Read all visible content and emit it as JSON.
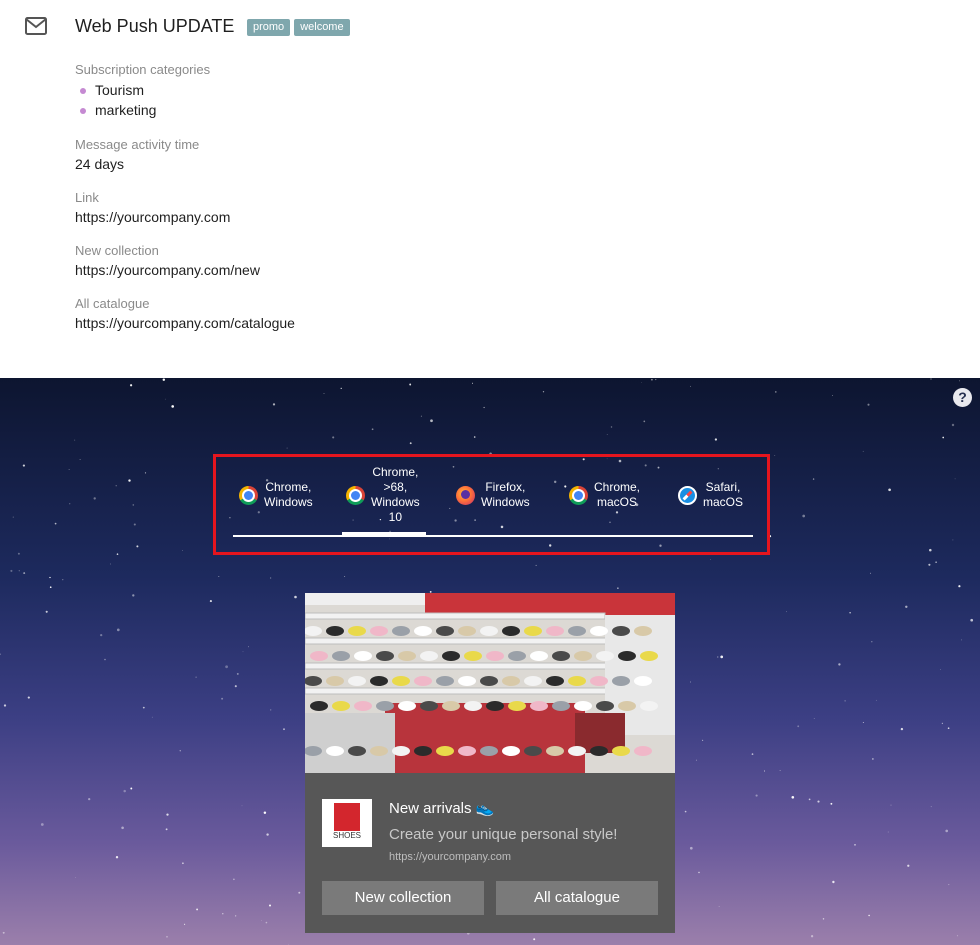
{
  "message": {
    "title": "Web Push UPDATE",
    "tags": [
      "promo",
      "welcome"
    ]
  },
  "fields": {
    "subscription_label": "Subscription categories",
    "subscription_items": [
      "Tourism",
      "marketing"
    ],
    "activity_label": "Message activity time",
    "activity_value": "24 days",
    "link_label": "Link",
    "link_value": "https://yourcompany.com",
    "new_collection_label": "New collection",
    "new_collection_value": "https://yourcompany.com/new",
    "catalogue_label": "All catalogue",
    "catalogue_value": "https://yourcompany.com/catalogue"
  },
  "preview": {
    "help_icon": "?",
    "browser_tabs": [
      {
        "label": "Chrome,\nWindows",
        "icon": "chrome-icon"
      },
      {
        "label": "Chrome,\n>68,\nWindows\n10",
        "icon": "chrome-icon",
        "active": true
      },
      {
        "label": "Firefox,\nWindows",
        "icon": "firefox-icon"
      },
      {
        "label": "Chrome,\nmacOS",
        "icon": "chrome-icon"
      },
      {
        "label": "Safari,\nmacOS",
        "icon": "safari-icon"
      }
    ],
    "notification": {
      "title": "New arrivals 👟",
      "text": "Create your unique personal style!",
      "url": "https://yourcompany.com",
      "logo_text": "SHOES",
      "button_1": "New collection",
      "button_2": "All catalogue"
    }
  },
  "colors": {
    "tag_bg": "#7fa7ad",
    "bullet": "#c58ad2",
    "highlight_border": "#e5151e",
    "card_bg": "#575757",
    "button_bg": "#7a7a7a"
  }
}
